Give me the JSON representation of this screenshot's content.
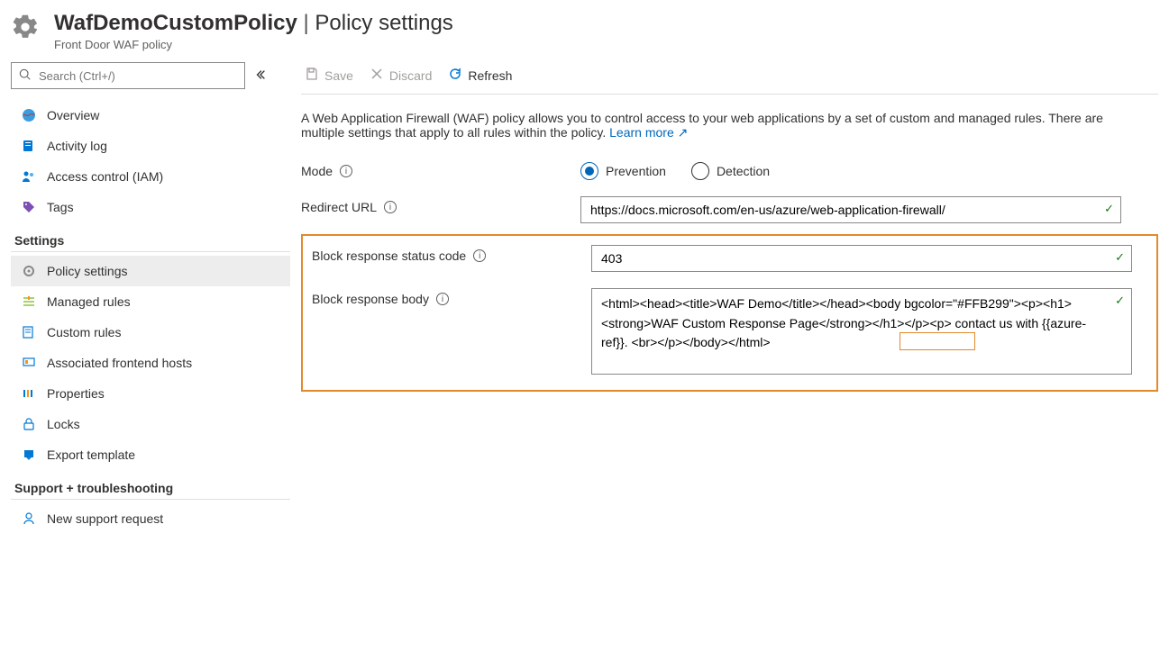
{
  "header": {
    "title_name": "WafDemoCustomPolicy",
    "title_section": "Policy settings",
    "subtitle": "Front Door WAF policy"
  },
  "sidebar": {
    "search_placeholder": "Search (Ctrl+/)",
    "groups": {
      "main": [
        {
          "label": "Overview"
        },
        {
          "label": "Activity log"
        },
        {
          "label": "Access control (IAM)"
        },
        {
          "label": "Tags"
        }
      ],
      "settings_label": "Settings",
      "settings": [
        {
          "label": "Policy settings"
        },
        {
          "label": "Managed rules"
        },
        {
          "label": "Custom rules"
        },
        {
          "label": "Associated frontend hosts"
        },
        {
          "label": "Properties"
        },
        {
          "label": "Locks"
        },
        {
          "label": "Export template"
        }
      ],
      "support_label": "Support + troubleshooting",
      "support": [
        {
          "label": "New support request"
        }
      ]
    }
  },
  "toolbar": {
    "save": "Save",
    "discard": "Discard",
    "refresh": "Refresh"
  },
  "description": {
    "text": "A Web Application Firewall (WAF) policy allows you to control access to your web applications by a set of custom and managed rules. There are multiple settings that apply to all rules within the policy. ",
    "learn_more": "Learn more"
  },
  "form": {
    "mode": {
      "label": "Mode",
      "options": {
        "prevention": "Prevention",
        "detection": "Detection"
      },
      "selected": "prevention"
    },
    "redirect_url": {
      "label": "Redirect URL",
      "value": "https://docs.microsoft.com/en-us/azure/web-application-firewall/"
    },
    "block_status": {
      "label": "Block response status code",
      "value": "403"
    },
    "block_body": {
      "label": "Block response body",
      "value": "<html><head><title>WAF Demo</title></head><body bgcolor=\"#FFB299\"><p><h1><strong>WAF Custom Response Page</strong></h1></p><p> contact us with {{azure-ref}}. <br></p></body></html>"
    }
  }
}
